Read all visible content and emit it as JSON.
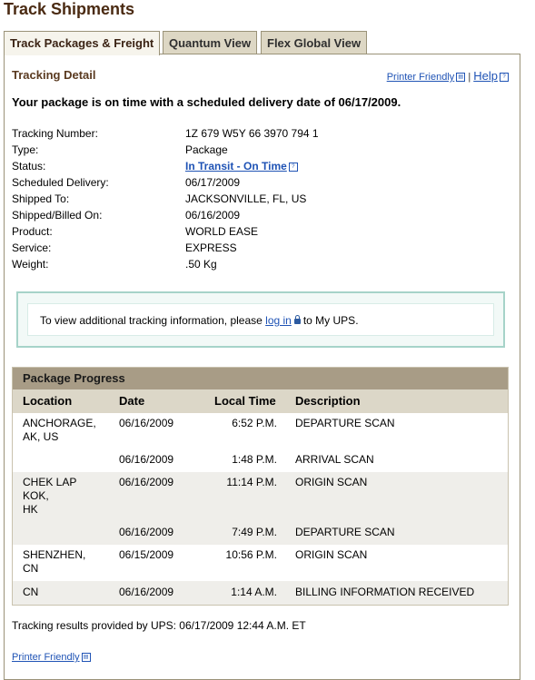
{
  "page": {
    "title": "Track Shipments"
  },
  "tabs": [
    {
      "label": "Track Packages & Freight",
      "active": true
    },
    {
      "label": "Quantum View",
      "active": false
    },
    {
      "label": "Flex Global View",
      "active": false
    }
  ],
  "tracking_detail": {
    "heading": "Tracking Detail",
    "printer_friendly": "Printer Friendly",
    "separator": "|",
    "help": "Help",
    "on_time_message": "Your package is on time with a scheduled delivery date of 06/17/2009."
  },
  "details": [
    {
      "label": "Tracking Number:",
      "value": "1Z 679 W5Y 66 3970 794 1"
    },
    {
      "label": "Type:",
      "value": "Package"
    },
    {
      "label": "Status:",
      "value": "In Transit - On Time",
      "link": true
    },
    {
      "label": "Scheduled Delivery:",
      "value": "06/17/2009"
    },
    {
      "label": "Shipped To:",
      "value": "JACKSONVILLE, FL, US"
    },
    {
      "label": "Shipped/Billed On:",
      "value": "06/16/2009"
    },
    {
      "label": "Product:",
      "value": "WORLD EASE"
    },
    {
      "label": "Service:",
      "value": "EXPRESS"
    },
    {
      "label": "Weight:",
      "value": ".50 Kg"
    }
  ],
  "info": {
    "before": "To view additional tracking information, please",
    "link": "log in",
    "after": "to My UPS."
  },
  "progress": {
    "title": "Package Progress",
    "columns": [
      "Location",
      "Date",
      "Local Time",
      "Description"
    ],
    "rows": [
      {
        "location": "ANCHORAGE,\nAK,  US",
        "date": "06/16/2009",
        "time": "6:52 P.M.",
        "desc": "DEPARTURE SCAN"
      },
      {
        "location": "",
        "date": "06/16/2009",
        "time": "1:48 P.M.",
        "desc": "ARRIVAL SCAN"
      },
      {
        "location": "CHEK LAP\nKOK,\nHK",
        "date": "06/16/2009",
        "time": "11:14 P.M.",
        "desc": "ORIGIN SCAN"
      },
      {
        "location": "",
        "date": "06/16/2009",
        "time": "7:49 P.M.",
        "desc": "DEPARTURE SCAN"
      },
      {
        "location": "SHENZHEN,\nCN",
        "date": "06/15/2009",
        "time": "10:56 P.M.",
        "desc": "ORIGIN SCAN"
      },
      {
        "location": "CN",
        "date": "06/16/2009",
        "time": "1:14 A.M.",
        "desc": "BILLING INFORMATION RECEIVED"
      }
    ]
  },
  "footer": {
    "results_text": "Tracking results provided by UPS:  06/17/2009 12:44 A.M.  ET",
    "printer_friendly": "Printer Friendly"
  },
  "colors": {
    "title": "#4a2a12",
    "link": "#1f53b5",
    "progress_header": "#a89c86",
    "columns_bg": "#dcd7c8",
    "info_border": "#a6d3c9"
  }
}
